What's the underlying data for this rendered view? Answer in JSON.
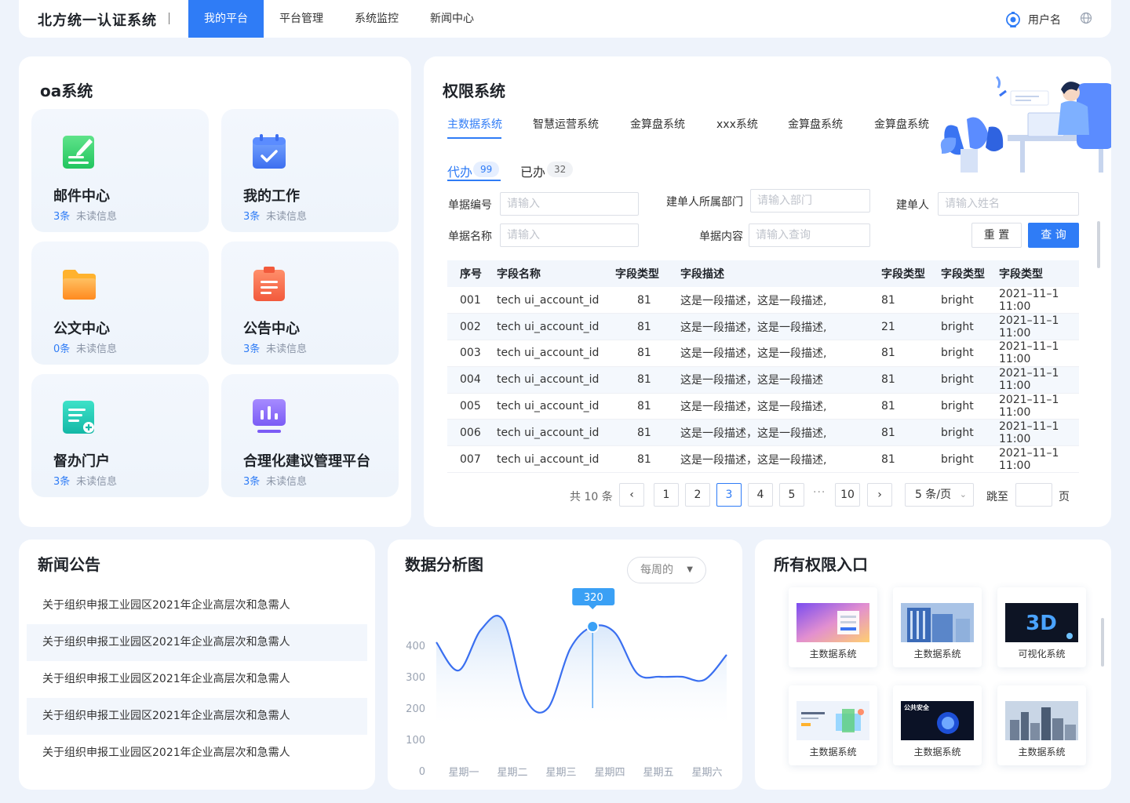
{
  "header": {
    "brand": "北方统一认证系统",
    "nav": [
      "我的平台",
      "平台管理",
      "系统监控",
      "新闻中心"
    ],
    "active_nav": "我的平台",
    "user_name": "用户名"
  },
  "oa": {
    "title": "oa系统",
    "tiles": [
      {
        "title": "邮件中心",
        "count": "3条",
        "unread": "未读信息",
        "icon": "email-icon"
      },
      {
        "title": "我的工作",
        "count": "3条",
        "unread": "未读信息",
        "icon": "calendar-icon"
      },
      {
        "title": "公文中心",
        "count": "0条",
        "unread": "未读信息",
        "icon": "folder-icon"
      },
      {
        "title": "公告中心",
        "count": "3条",
        "unread": "未读信息",
        "icon": "clipboard-icon"
      },
      {
        "title": "督办门户",
        "count": "3条",
        "unread": "未读信息",
        "icon": "document-icon"
      },
      {
        "title": "合理化建议管理平台",
        "count": "3条",
        "unread": "未读信息",
        "icon": "chart-board-icon"
      }
    ]
  },
  "permission": {
    "title": "权限系统",
    "tabs": [
      "主数据系统",
      "智慧运营系统",
      "金算盘系统",
      "xxx系统",
      "金算盘系统",
      "金算盘系统"
    ],
    "todo_label": "代办",
    "todo_count": "99",
    "done_label": "已办",
    "done_count": "32",
    "filters": {
      "doc_no": "单据编号",
      "doc_no_ph": "请输入",
      "dept": "建单人所属部门",
      "dept_ph": "请输入部门",
      "creator": "建单人",
      "creator_ph": "请输入姓名",
      "doc_name": "单据名称",
      "doc_name_ph": "请输入",
      "content": "单据内容",
      "content_ph": "请输入查询"
    },
    "reset_label": "重 置",
    "query_label": "查 询",
    "columns": [
      "序号",
      "字段名称",
      "字段类型",
      "字段描述",
      "字段类型",
      "字段类型",
      "字段类型"
    ],
    "rows": [
      [
        "001",
        "tech ui_account_id",
        "81",
        "这是一段描述，这是一段描述,",
        "81",
        "bright",
        "2021–11–1 11:00"
      ],
      [
        "002",
        "tech ui_account_id",
        "81",
        "这是一段描述，这是一段描述,",
        "21",
        "bright",
        "2021–11–1 11:00"
      ],
      [
        "003",
        "tech ui_account_id",
        "81",
        "这是一段描述，这是一段描述,",
        "81",
        "bright",
        "2021–11–1 11:00"
      ],
      [
        "004",
        "tech ui_account_id",
        "81",
        "这是一段描述，这是一段描述",
        "81",
        "bright",
        "2021–11–1 11:00"
      ],
      [
        "005",
        "tech ui_account_id",
        "81",
        "这是一段描述，这是一段描述,",
        "81",
        "bright",
        "2021–11–1 11:00"
      ],
      [
        "006",
        "tech ui_account_id",
        "81",
        "这是一段描述，这是一段描述,",
        "81",
        "bright",
        "2021–11–1 11:00"
      ],
      [
        "007",
        "tech ui_account_id",
        "81",
        "这是一段描述，这是一段描述,",
        "81",
        "bright",
        "2021–11–1 11:00"
      ]
    ],
    "pagination": {
      "total": "共 10 条",
      "pages": [
        "1",
        "2",
        "3",
        "4",
        "5"
      ],
      "current": "3",
      "last": "10",
      "dots": "···",
      "page_size": "5 条/页",
      "jump": "跳至",
      "page_unit": "页"
    }
  },
  "news": {
    "title": "新闻公告",
    "items": [
      "关于组织申报工业园区2021年企业高层次和急需人",
      "关于组织申报工业园区2021年企业高层次和急需人",
      "关于组织申报工业园区2021年企业高层次和急需人",
      "关于组织申报工业园区2021年企业高层次和急需人",
      "关于组织申报工业园区2021年企业高层次和急需人"
    ]
  },
  "analysis": {
    "title": "数据分析图",
    "dropdown": "每周的",
    "tooltip": "320",
    "chart_data": {
      "type": "area",
      "categories": [
        "星期一",
        "星期二",
        "星期三",
        "星期四",
        "星期五",
        "星期六"
      ],
      "yticks": [
        "0",
        "100",
        "200",
        "300",
        "400"
      ],
      "ylim": [
        0,
        500
      ],
      "series": [
        {
          "values": [
            410,
            320,
            450,
            480,
            230,
            200,
            390,
            460,
            440,
            310,
            300,
            300,
            290,
            370
          ]
        }
      ],
      "highlight": {
        "category": "星期四",
        "value": "320"
      },
      "color": "#3a6ff0"
    }
  },
  "entries": {
    "title": "所有权限入口",
    "items": [
      "主数据系统",
      "主数据系统",
      "可视化系统",
      "主数据系统",
      "主数据系统",
      "主数据系统"
    ]
  }
}
